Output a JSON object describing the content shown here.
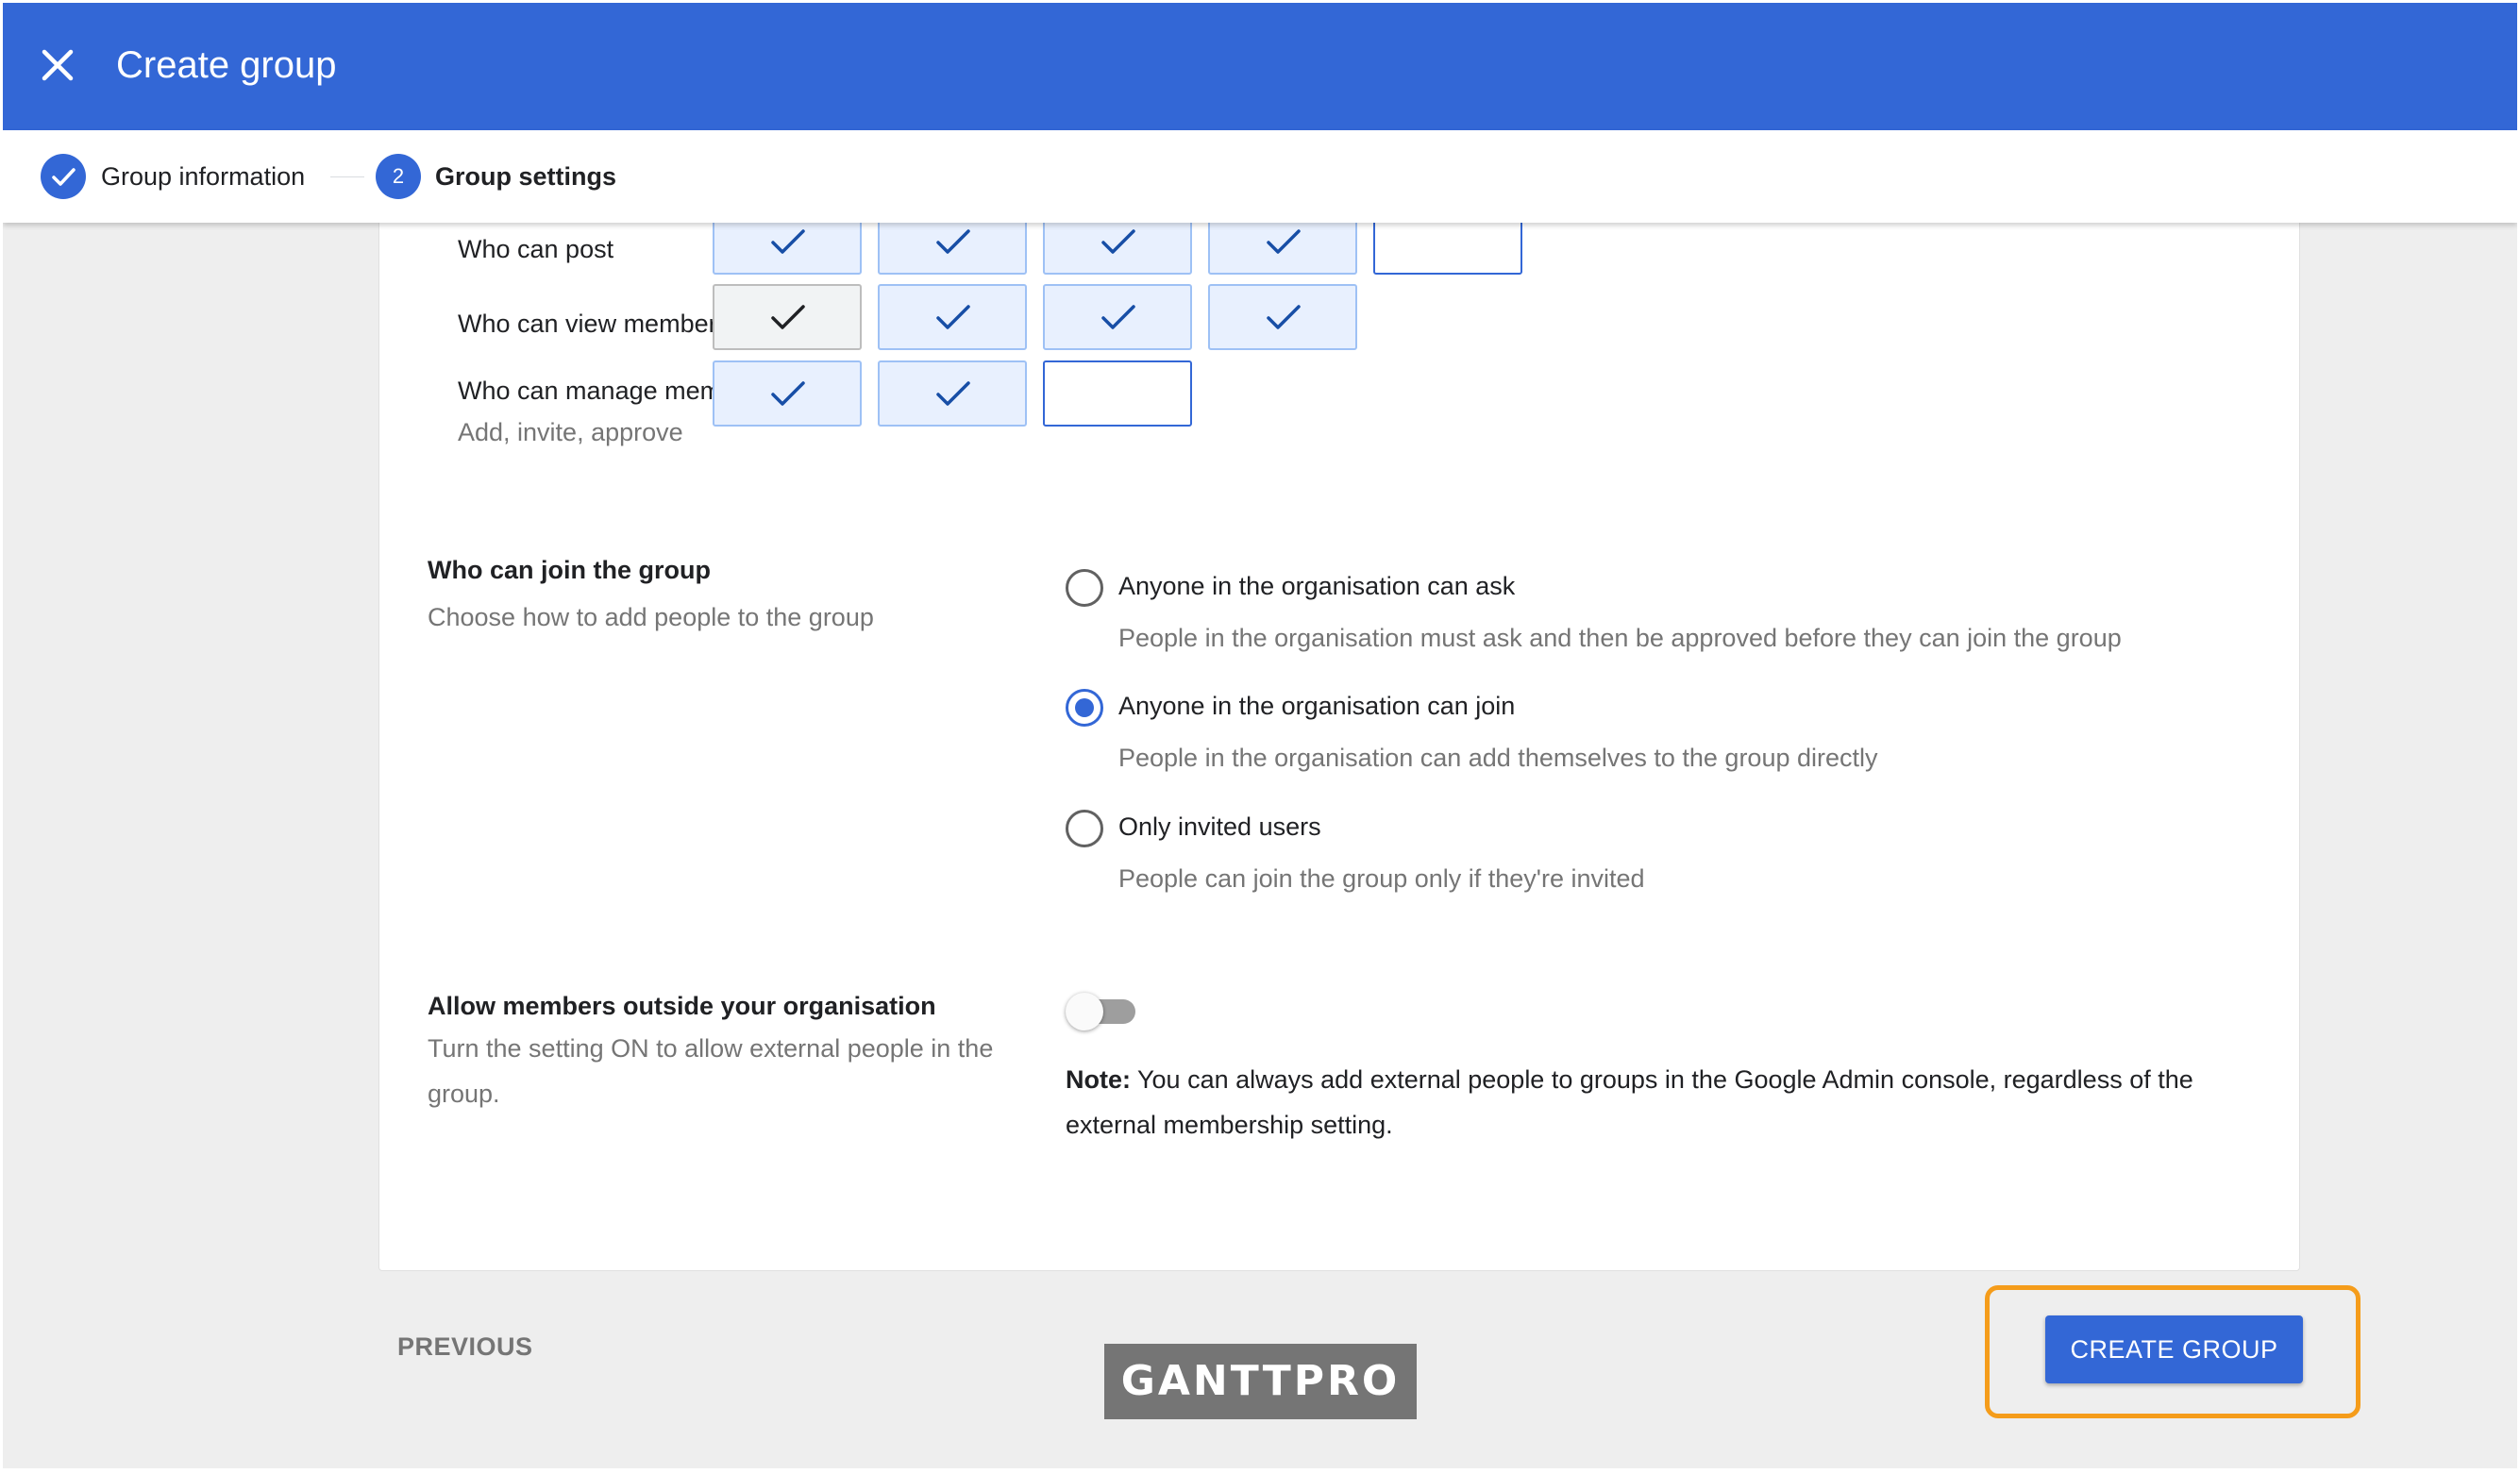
{
  "header": {
    "title": "Create group"
  },
  "stepper": {
    "step1": {
      "label": "Group information",
      "state": "completed"
    },
    "step2": {
      "number": "2",
      "label": "Group settings",
      "state": "active"
    }
  },
  "permissions": {
    "rows": [
      {
        "label": "Who can post",
        "sublabel": "",
        "cells": [
          "on",
          "on",
          "on",
          "on",
          "off"
        ]
      },
      {
        "label": "Who can view members",
        "sublabel": "",
        "cells": [
          "grey",
          "on",
          "on",
          "on"
        ]
      },
      {
        "label": "Who can manage members",
        "sublabel": "Add, invite, approve",
        "cells": [
          "on",
          "on",
          "off"
        ]
      }
    ]
  },
  "join": {
    "title": "Who can join the group",
    "description": "Choose how to add people to the group",
    "options": [
      {
        "label": "Anyone in the organisation can ask",
        "description": "People in the organisation must ask and then be approved before they can join the group",
        "selected": false
      },
      {
        "label": "Anyone in the organisation can join",
        "description": "People in the organisation can add themselves to the group directly",
        "selected": true
      },
      {
        "label": "Only invited users",
        "description": "People can join the group only if they're invited",
        "selected": false
      }
    ]
  },
  "external": {
    "title": "Allow members outside your organisation",
    "description": "Turn the setting ON to allow external people in the group.",
    "enabled": false,
    "note_label": "Note:",
    "note_text": " You can always add external people to groups in the Google Admin console, regardless of the external membership setting."
  },
  "footer": {
    "previous_label": "PREVIOUS",
    "create_label": "CREATE GROUP",
    "watermark": "GANTTPRO"
  },
  "colors": {
    "primary": "#3367d6",
    "highlight": "#f59c1a",
    "cell_on": "#e8f0fe",
    "cell_grey": "#f1f3f4"
  }
}
